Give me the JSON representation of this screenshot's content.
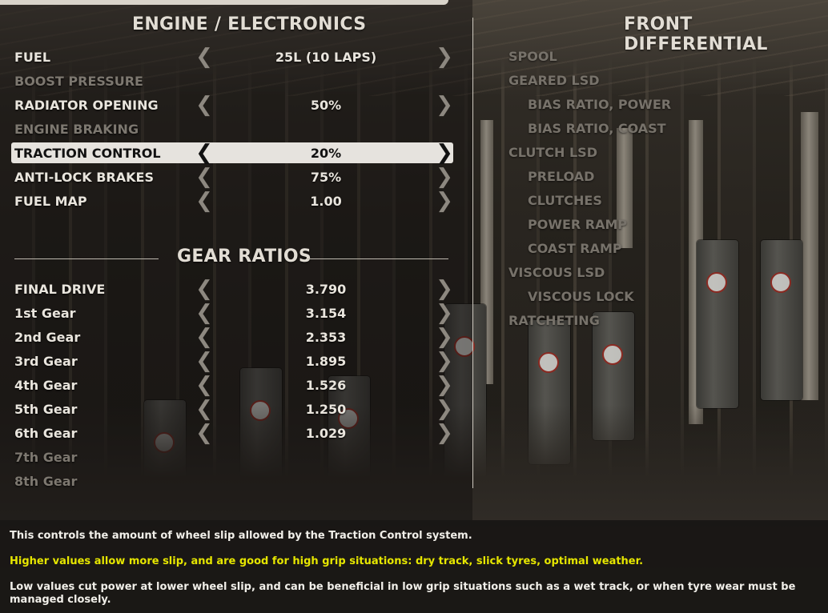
{
  "engine": {
    "title": "ENGINE / ELECTRONICS",
    "rows": [
      {
        "label": "FUEL",
        "value": "25L  (10 LAPS)",
        "state": "normal"
      },
      {
        "label": "BOOST PRESSURE",
        "value": "",
        "state": "dim"
      },
      {
        "label": "RADIATOR OPENING",
        "value": "50%",
        "state": "normal"
      },
      {
        "label": "ENGINE BRAKING",
        "value": "",
        "state": "dim"
      },
      {
        "label": "TRACTION CONTROL",
        "value": "20%",
        "state": "selected"
      },
      {
        "label": "ANTI-LOCK BRAKES",
        "value": "75%",
        "state": "normal"
      },
      {
        "label": "FUEL MAP",
        "value": "1.00",
        "state": "normal"
      }
    ]
  },
  "gears": {
    "title": "GEAR RATIOS",
    "rows": [
      {
        "label": "FINAL DRIVE",
        "value": "3.790",
        "state": "normal"
      },
      {
        "label": "1st Gear",
        "value": "3.154",
        "state": "normal"
      },
      {
        "label": "2nd Gear",
        "value": "2.353",
        "state": "normal"
      },
      {
        "label": "3rd Gear",
        "value": "1.895",
        "state": "normal"
      },
      {
        "label": "4th Gear",
        "value": "1.526",
        "state": "normal"
      },
      {
        "label": "5th Gear",
        "value": "1.250",
        "state": "normal"
      },
      {
        "label": "6th Gear",
        "value": "1.029",
        "state": "normal"
      },
      {
        "label": "7th Gear",
        "value": "",
        "state": "dim"
      },
      {
        "label": "8th Gear",
        "value": "",
        "state": "dim"
      }
    ]
  },
  "differential": {
    "title": "FRONT DIFFERENTIAL",
    "items": [
      {
        "label": "SPOOL",
        "indent": 0
      },
      {
        "label": "GEARED LSD",
        "indent": 0
      },
      {
        "label": "BIAS RATIO, POWER",
        "indent": 1
      },
      {
        "label": "BIAS RATIO, COAST",
        "indent": 1
      },
      {
        "label": "CLUTCH LSD",
        "indent": 0
      },
      {
        "label": "PRELOAD",
        "indent": 1
      },
      {
        "label": "CLUTCHES",
        "indent": 1
      },
      {
        "label": "POWER RAMP",
        "indent": 1
      },
      {
        "label": "COAST RAMP",
        "indent": 1
      },
      {
        "label": "VISCOUS LSD",
        "indent": 0
      },
      {
        "label": "VISCOUS LOCK",
        "indent": 1
      },
      {
        "label": "RATCHETING",
        "indent": 0
      }
    ]
  },
  "description": {
    "line1": "This controls the amount of wheel slip allowed by the Traction Control system.",
    "line2": "Higher values allow more slip, and are good for high grip situations: dry track, slick tyres, optimal weather.",
    "line3": "Low values cut power at lower wheel slip, and can be beneficial in low grip situations such as a wet track, or when tyre wear must be managed closely."
  },
  "colors": {
    "highlight_text": "#e6e600",
    "selected_bg": "#e6e3de",
    "dim_text": "#7d7870"
  },
  "icons": {
    "decrease": "chevron-left-icon",
    "increase": "chevron-right-icon"
  }
}
